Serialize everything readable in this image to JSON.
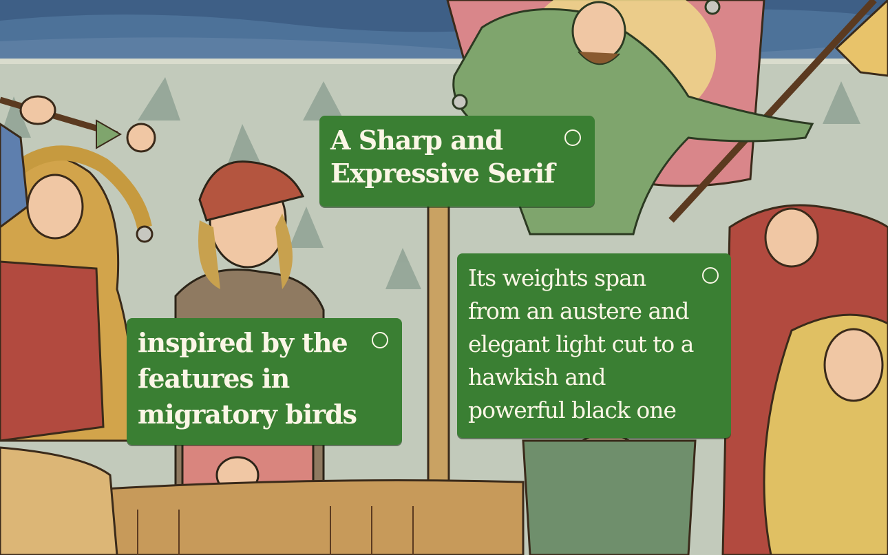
{
  "cards": [
    {
      "text": "A Sharp and\nExpressive Serif"
    },
    {
      "text": "inspired by the\nfeatures in\nmigratory birds"
    },
    {
      "text": "Its weights span\nfrom an austere and\nelegant light cut to a\nhawkish and\npowerful black one"
    }
  ],
  "colors": {
    "card_bg": "#3a7f33",
    "card_text": "#fbf6e6",
    "sea": "#c3cbbc",
    "sky": "#4a6f95"
  }
}
